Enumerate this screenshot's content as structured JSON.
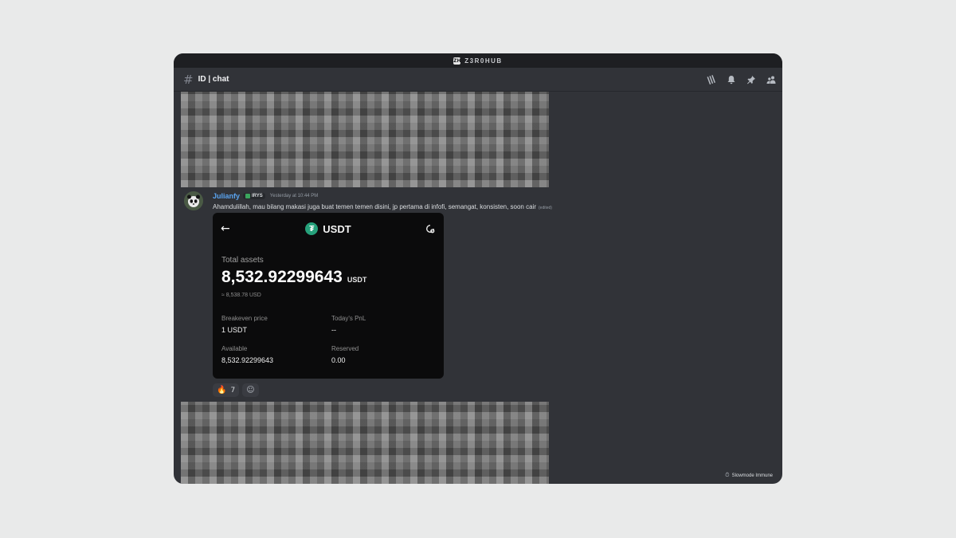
{
  "window": {
    "server_icon": "ZH",
    "server_name": "Z3R0HUB"
  },
  "channel": {
    "hash_icon": "#",
    "name": "ID | chat",
    "toolbar_icons": [
      "threads-icon",
      "bell-icon",
      "pin-icon",
      "members-icon"
    ]
  },
  "message": {
    "author": "Julianfy",
    "tag": "IRYS",
    "timestamp": "Yesterday at 10:44 PM",
    "text": "Ahamdulillah, mau bilang makasi juga buat temen temen disini, jp pertama di infofi, semangat, konsisten, soon cair",
    "edited": "(edited)"
  },
  "card": {
    "back_icon": "←",
    "logo_glyph": "₮",
    "title": "USDT",
    "total_label": "Total assets",
    "total_value": "8,532.92299643",
    "total_unit": "USDT",
    "approx": "≈ 8,538.78 USD",
    "stats": [
      {
        "label": "Breakeven price",
        "value": "1 USDT"
      },
      {
        "label": "Today's PnL",
        "value": "--"
      },
      {
        "label": "Available",
        "value": "8,532.92299643"
      },
      {
        "label": "Reserved",
        "value": "0.00"
      }
    ]
  },
  "reactions": [
    {
      "emoji": "🔥",
      "count": "7"
    }
  ],
  "add_reaction_icon": "☺",
  "footer": {
    "slowmode_label": "Slowmode Immune",
    "slowmode_icon": "⏱"
  },
  "colors": {
    "window_bg": "#313338",
    "titlebar_bg": "#1e1f22",
    "username": "#5aa4f0",
    "usdt_green": "#26a17b"
  }
}
